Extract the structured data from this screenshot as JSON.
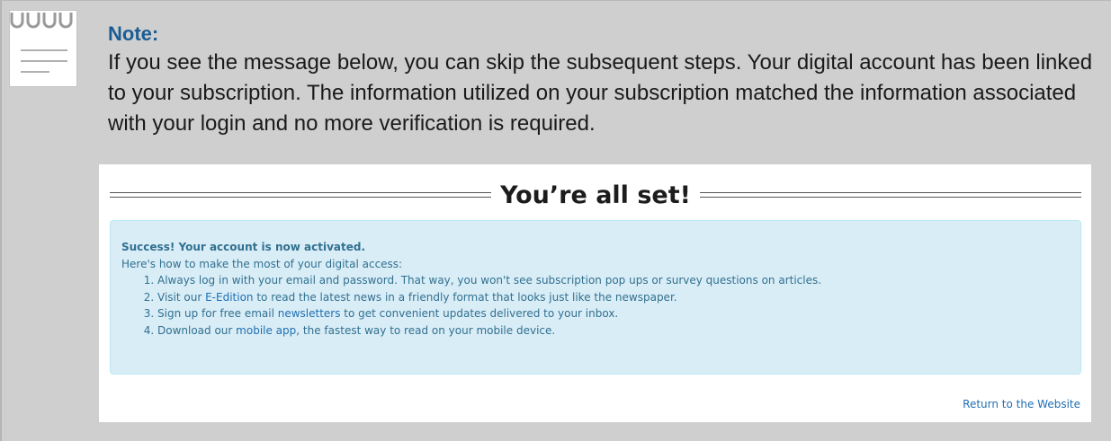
{
  "note": {
    "title": "Note:",
    "text": "If you see the message below, you can skip the subsequent steps. Your digital account has been linked to your subscription. The information utilized on your subscription matched the information associated with your login and no more verification is required."
  },
  "screenshot": {
    "heading": "You’re all set!",
    "alert": {
      "title": "Success! Your account is now activated.",
      "intro": "Here's how to make the most of your digital access:",
      "items": [
        {
          "before": "Always log in with your email and password. That way, you won't see subscription pop ups or survey questions on articles.",
          "link": "",
          "after": ""
        },
        {
          "before": "Visit our ",
          "link": "E-Edition",
          "after": " to read the latest news in a friendly format that looks just like the newspaper."
        },
        {
          "before": "Sign up for free email ",
          "link": "newsletters",
          "after": " to get convenient updates delivered to your inbox."
        },
        {
          "before": "Download our ",
          "link": "mobile app",
          "after": ", the fastest way to read on your mobile device."
        }
      ]
    },
    "return_link": "Return to the Website"
  },
  "icons": {
    "note": "note-paper-icon"
  },
  "colors": {
    "note_title": "#1a5d94",
    "alert_bg": "#d9edf7",
    "alert_text": "#31708f",
    "link": "#1f6fb2"
  }
}
